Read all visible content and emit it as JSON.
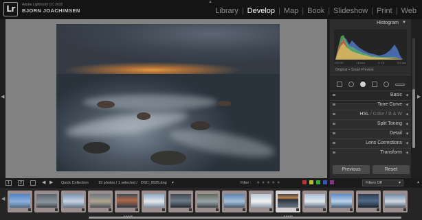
{
  "identity": {
    "logo": "Lr",
    "app_name": "Adobe Lightroom CC 2015",
    "user_name": "BJORN JOACHIMSEN"
  },
  "modules": [
    {
      "label": "Library",
      "active": false
    },
    {
      "label": "Develop",
      "active": true
    },
    {
      "label": "Map",
      "active": false
    },
    {
      "label": "Book",
      "active": false
    },
    {
      "label": "Slideshow",
      "active": false
    },
    {
      "label": "Print",
      "active": false
    },
    {
      "label": "Web",
      "active": false
    }
  ],
  "right_panel": {
    "histogram": {
      "title": "Histogram",
      "stats": [
        "ISO 50",
        "16 mm",
        "f / 16",
        "0,6 sec"
      ],
      "note": "Original + Smart Preview"
    },
    "sections": [
      {
        "label": "Basic"
      },
      {
        "label": "Tone Curve"
      },
      {
        "label": "HSL / Color / B & W"
      },
      {
        "label": "Split Toning"
      },
      {
        "label": "Detail"
      },
      {
        "label": "Lens Corrections"
      },
      {
        "label": "Transform"
      }
    ],
    "hsl_parts": [
      "HSL",
      "Color",
      "B & W"
    ],
    "previous_button": "Previous",
    "reset_button": "Reset"
  },
  "filmstrip_bar": {
    "page1": "1",
    "page2": "2",
    "source": "Quick Collection",
    "count_text": "19 photos / 1 selected /",
    "filename": "DSC_8925.dng",
    "filter_label": "Filter :",
    "filters_value": "Filters Off"
  },
  "colors": {
    "active_module": "#ffffff",
    "inactive_module": "#8c8c8c",
    "background": "#818181",
    "thumb_selected": "#c0afaf"
  },
  "icons": {
    "left_edge": "triangle-left-icon",
    "right_edge": "triangle-right-icon",
    "histogram_collapse": "triangle-down-icon",
    "section_arrows": "triangle-left-icon"
  }
}
